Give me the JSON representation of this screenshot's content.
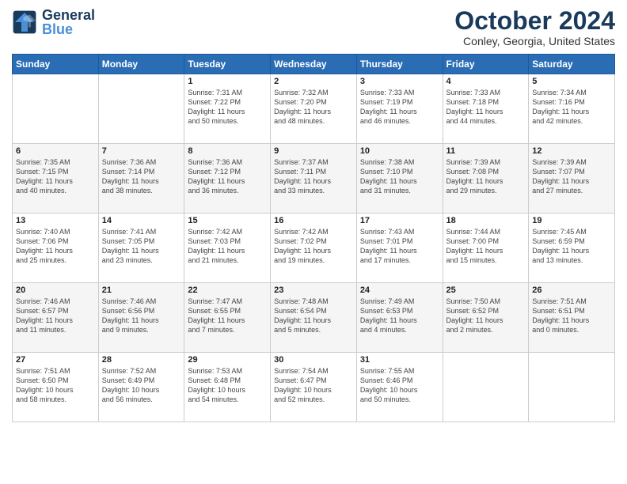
{
  "logo": {
    "text_general": "General",
    "text_blue": "Blue"
  },
  "header": {
    "month": "October 2024",
    "location": "Conley, Georgia, United States"
  },
  "days_of_week": [
    "Sunday",
    "Monday",
    "Tuesday",
    "Wednesday",
    "Thursday",
    "Friday",
    "Saturday"
  ],
  "weeks": [
    [
      {
        "day": "",
        "info": ""
      },
      {
        "day": "",
        "info": ""
      },
      {
        "day": "1",
        "info": "Sunrise: 7:31 AM\nSunset: 7:22 PM\nDaylight: 11 hours and 50 minutes."
      },
      {
        "day": "2",
        "info": "Sunrise: 7:32 AM\nSunset: 7:20 PM\nDaylight: 11 hours and 48 minutes."
      },
      {
        "day": "3",
        "info": "Sunrise: 7:33 AM\nSunset: 7:19 PM\nDaylight: 11 hours and 46 minutes."
      },
      {
        "day": "4",
        "info": "Sunrise: 7:33 AM\nSunset: 7:18 PM\nDaylight: 11 hours and 44 minutes."
      },
      {
        "day": "5",
        "info": "Sunrise: 7:34 AM\nSunset: 7:16 PM\nDaylight: 11 hours and 42 minutes."
      }
    ],
    [
      {
        "day": "6",
        "info": "Sunrise: 7:35 AM\nSunset: 7:15 PM\nDaylight: 11 hours and 40 minutes."
      },
      {
        "day": "7",
        "info": "Sunrise: 7:36 AM\nSunset: 7:14 PM\nDaylight: 11 hours and 38 minutes."
      },
      {
        "day": "8",
        "info": "Sunrise: 7:36 AM\nSunset: 7:12 PM\nDaylight: 11 hours and 36 minutes."
      },
      {
        "day": "9",
        "info": "Sunrise: 7:37 AM\nSunset: 7:11 PM\nDaylight: 11 hours and 33 minutes."
      },
      {
        "day": "10",
        "info": "Sunrise: 7:38 AM\nSunset: 7:10 PM\nDaylight: 11 hours and 31 minutes."
      },
      {
        "day": "11",
        "info": "Sunrise: 7:39 AM\nSunset: 7:08 PM\nDaylight: 11 hours and 29 minutes."
      },
      {
        "day": "12",
        "info": "Sunrise: 7:39 AM\nSunset: 7:07 PM\nDaylight: 11 hours and 27 minutes."
      }
    ],
    [
      {
        "day": "13",
        "info": "Sunrise: 7:40 AM\nSunset: 7:06 PM\nDaylight: 11 hours and 25 minutes."
      },
      {
        "day": "14",
        "info": "Sunrise: 7:41 AM\nSunset: 7:05 PM\nDaylight: 11 hours and 23 minutes."
      },
      {
        "day": "15",
        "info": "Sunrise: 7:42 AM\nSunset: 7:03 PM\nDaylight: 11 hours and 21 minutes."
      },
      {
        "day": "16",
        "info": "Sunrise: 7:42 AM\nSunset: 7:02 PM\nDaylight: 11 hours and 19 minutes."
      },
      {
        "day": "17",
        "info": "Sunrise: 7:43 AM\nSunset: 7:01 PM\nDaylight: 11 hours and 17 minutes."
      },
      {
        "day": "18",
        "info": "Sunrise: 7:44 AM\nSunset: 7:00 PM\nDaylight: 11 hours and 15 minutes."
      },
      {
        "day": "19",
        "info": "Sunrise: 7:45 AM\nSunset: 6:59 PM\nDaylight: 11 hours and 13 minutes."
      }
    ],
    [
      {
        "day": "20",
        "info": "Sunrise: 7:46 AM\nSunset: 6:57 PM\nDaylight: 11 hours and 11 minutes."
      },
      {
        "day": "21",
        "info": "Sunrise: 7:46 AM\nSunset: 6:56 PM\nDaylight: 11 hours and 9 minutes."
      },
      {
        "day": "22",
        "info": "Sunrise: 7:47 AM\nSunset: 6:55 PM\nDaylight: 11 hours and 7 minutes."
      },
      {
        "day": "23",
        "info": "Sunrise: 7:48 AM\nSunset: 6:54 PM\nDaylight: 11 hours and 5 minutes."
      },
      {
        "day": "24",
        "info": "Sunrise: 7:49 AM\nSunset: 6:53 PM\nDaylight: 11 hours and 4 minutes."
      },
      {
        "day": "25",
        "info": "Sunrise: 7:50 AM\nSunset: 6:52 PM\nDaylight: 11 hours and 2 minutes."
      },
      {
        "day": "26",
        "info": "Sunrise: 7:51 AM\nSunset: 6:51 PM\nDaylight: 11 hours and 0 minutes."
      }
    ],
    [
      {
        "day": "27",
        "info": "Sunrise: 7:51 AM\nSunset: 6:50 PM\nDaylight: 10 hours and 58 minutes."
      },
      {
        "day": "28",
        "info": "Sunrise: 7:52 AM\nSunset: 6:49 PM\nDaylight: 10 hours and 56 minutes."
      },
      {
        "day": "29",
        "info": "Sunrise: 7:53 AM\nSunset: 6:48 PM\nDaylight: 10 hours and 54 minutes."
      },
      {
        "day": "30",
        "info": "Sunrise: 7:54 AM\nSunset: 6:47 PM\nDaylight: 10 hours and 52 minutes."
      },
      {
        "day": "31",
        "info": "Sunrise: 7:55 AM\nSunset: 6:46 PM\nDaylight: 10 hours and 50 minutes."
      },
      {
        "day": "",
        "info": ""
      },
      {
        "day": "",
        "info": ""
      }
    ]
  ]
}
